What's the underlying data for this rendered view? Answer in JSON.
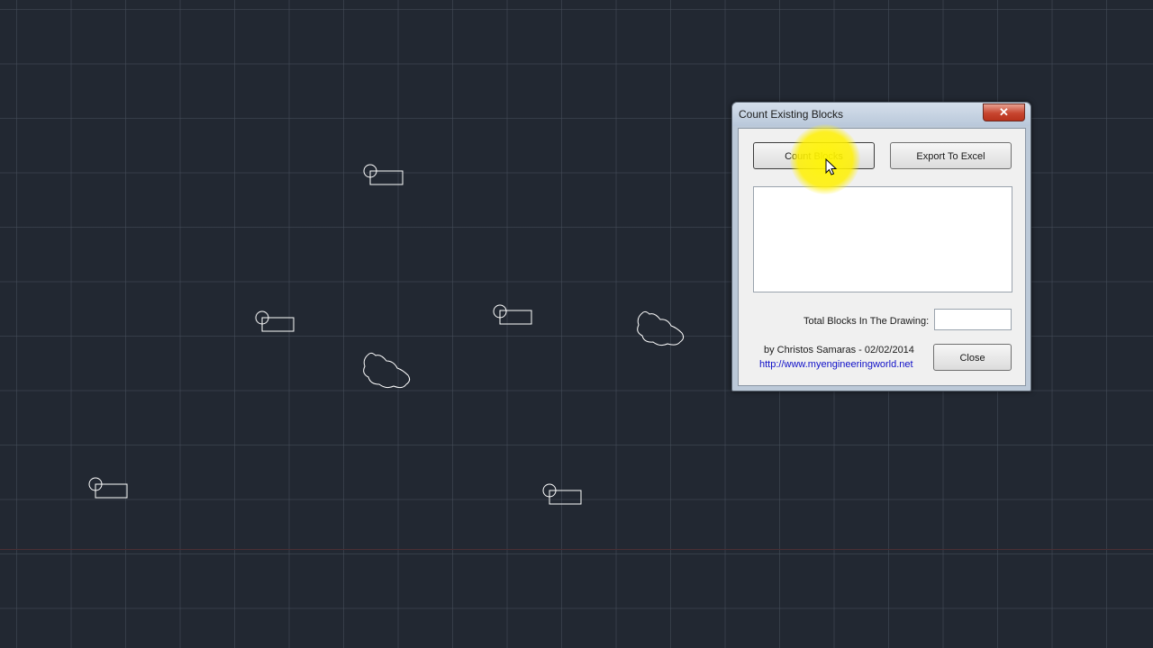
{
  "dialog": {
    "title": "Count Existing Blocks",
    "close_glyph": "✕",
    "count_button": "Count Blocks",
    "export_button": "Export To Excel",
    "total_label": "Total Blocks In The Drawing:",
    "total_value": "",
    "author": "by Christos Samaras - 02/02/2014",
    "website": "http://www.myengineeringworld.net",
    "close_button": "Close"
  },
  "icons": {
    "window_close": "close-x-icon",
    "cursor": "mouse-pointer-icon",
    "click_highlight": "click-highlight"
  },
  "colors": {
    "model_space_background": "#222832",
    "grid_line": "#464e5a",
    "drawing_entities": "#ffffff",
    "highlight": "#fff000",
    "link": "#1010c8"
  }
}
